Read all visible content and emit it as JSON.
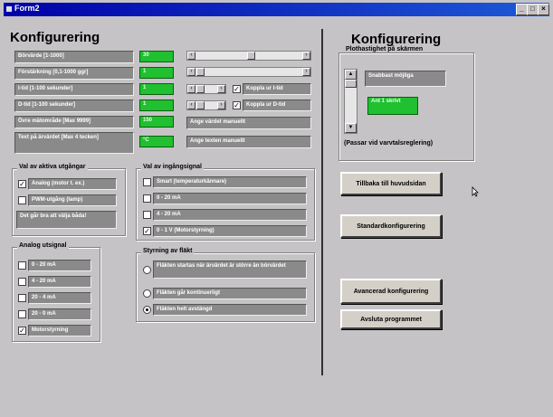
{
  "window": {
    "title": "Form2"
  },
  "left": {
    "heading": "Konfigurering",
    "params": [
      {
        "label": "Börvärde [1-1000]",
        "value": "30"
      },
      {
        "label": "Förstärkning  [0,1-1000 ggr]",
        "value": "1"
      },
      {
        "label": "I-tid   [1-100 sekunder]",
        "value": "1"
      },
      {
        "label": "D-tid   [1-100 sekunder]",
        "value": "1"
      },
      {
        "label": "Övre mätområde [Max 9999]",
        "value": "150"
      },
      {
        "label": "Text på ärvärdet [Max 4 tecken]",
        "value": "°C"
      }
    ],
    "couple_i": "Koppla ur I-tid",
    "couple_d": "Koppla ur D-tid",
    "manual_value": "Ange värdet manuellt",
    "manual_text": "Ange texten manuellt",
    "active_output": {
      "title": "Val av aktiva utgångar",
      "options": [
        "Analog (motor t. ex.)",
        "PWM-utgång (lamp)"
      ],
      "checked": [
        true,
        false
      ],
      "note": "Det går bra att välja båda!"
    },
    "analog_output": {
      "title": "Analog utsignal",
      "options": [
        "0 - 20 mA",
        "4 - 20 mA",
        "20 - 4 mA",
        "20 - 0 mA",
        "Motorstyrning"
      ],
      "checked": [
        false,
        false,
        false,
        false,
        true
      ]
    },
    "input_signal": {
      "title": "Val av ingångsignal",
      "options": [
        "Smart (temperaturkännare)",
        "0 - 20 mA",
        "4 - 20 mA",
        "0 - 1 V (Motorstyrning)"
      ],
      "checked": [
        false,
        false,
        false,
        true
      ]
    },
    "fan_control": {
      "title": "Styrning av fläkt",
      "options": [
        "Fläkten startas när ärvärdet är större än börvärdet",
        "Fläkten går kontinuerligt",
        "Fläkten helt avstängd"
      ],
      "selected": 2
    }
  },
  "right": {
    "heading": "Konfigurering",
    "plot_title": "Plothastighet på skärmen",
    "slider_label": "Snabbast möjliga",
    "slider_value": "Ant 1 skrivt",
    "note": "(Passar vid varvtalsreglering)",
    "buttons": {
      "back": "Tillbaka till huvudsidan",
      "standard": "Standardkonfigurering",
      "advanced": "Avancerad konfigurering",
      "exit": "Avsluta programmet"
    }
  }
}
